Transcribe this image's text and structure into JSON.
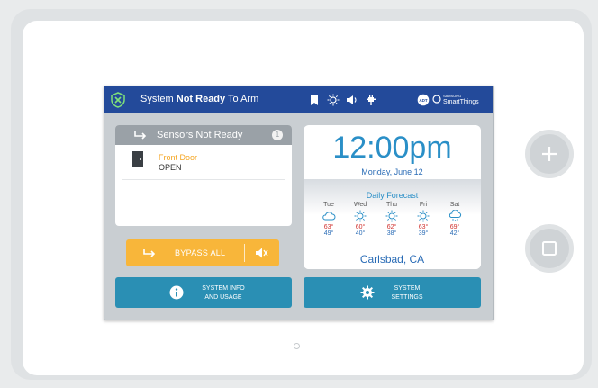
{
  "status": {
    "prefix": "System",
    "bold": "Not Ready",
    "suffix": "To Arm"
  },
  "topbar_icons": [
    "bookmark-icon",
    "sun-icon",
    "speaker-icon",
    "plug-icon",
    "adt-logo-icon"
  ],
  "brand": {
    "samsung": "SAMSUNG",
    "smartthings": "SmartThings"
  },
  "sensors": {
    "title": "Sensors Not Ready",
    "count": "1",
    "items": [
      {
        "name": "Front Door",
        "state": "OPEN"
      }
    ]
  },
  "bypass": {
    "label": "BYPASS ALL"
  },
  "buttons": {
    "info": {
      "line1": "SYSTEM INFO",
      "line2": "AND USAGE"
    },
    "settings": {
      "line1": "SYSTEM",
      "line2": "SETTINGS"
    }
  },
  "clock": {
    "time": "12:00pm",
    "date": "Monday, June 12"
  },
  "forecast": {
    "title": "Daily Forecast",
    "days": [
      {
        "name": "Tue",
        "icon": "cloud-icon",
        "hi": "63°",
        "lo": "49°"
      },
      {
        "name": "Wed",
        "icon": "sun-icon",
        "hi": "60°",
        "lo": "40°"
      },
      {
        "name": "Thu",
        "icon": "sun-icon",
        "hi": "62°",
        "lo": "38°"
      },
      {
        "name": "Fri",
        "icon": "sun-icon",
        "hi": "63°",
        "lo": "39°"
      },
      {
        "name": "Sat",
        "icon": "rain-cloud-icon",
        "hi": "69°",
        "lo": "42°"
      }
    ],
    "city": "Carlsbad, CA"
  },
  "colors": {
    "topbar": "#234a9a",
    "accent_blue": "#2a8fb4",
    "bypass": "#f8b63a",
    "temp_high": "#d0322e",
    "temp_low": "#2a6cb6"
  }
}
